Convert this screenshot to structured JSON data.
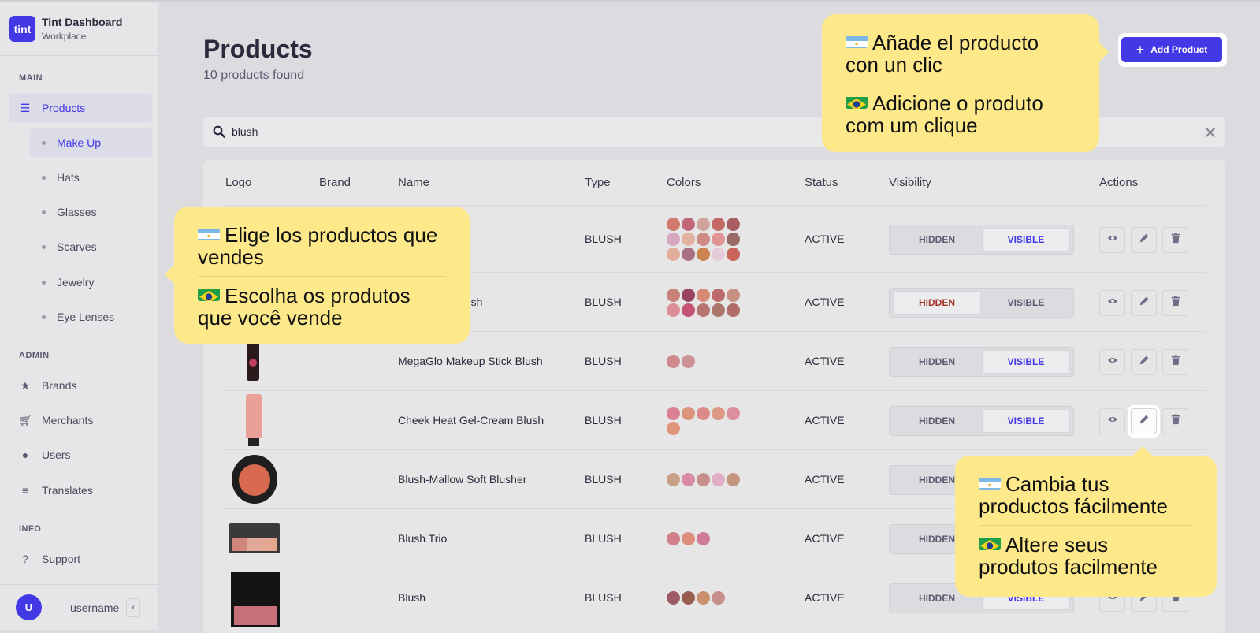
{
  "app": {
    "logo_text": "tint",
    "title": "Tint Dashboard",
    "subtitle": "Workplace"
  },
  "sidebar": {
    "sections": {
      "main": "MAIN",
      "admin": "ADMIN",
      "info": "INFO"
    },
    "products": {
      "label": "Products",
      "icon": "list-icon"
    },
    "subitems": [
      {
        "label": "Make Up"
      },
      {
        "label": "Hats"
      },
      {
        "label": "Glasses"
      },
      {
        "label": "Scarves"
      },
      {
        "label": "Jewelry"
      },
      {
        "label": "Eye Lenses"
      }
    ],
    "admin_items": [
      {
        "label": "Brands",
        "icon": "star-icon"
      },
      {
        "label": "Merchants",
        "icon": "cart-icon"
      },
      {
        "label": "Users",
        "icon": "user-icon"
      },
      {
        "label": "Translates",
        "icon": "text-lines-icon"
      }
    ],
    "info_items": [
      {
        "label": "Support",
        "icon": "question-icon"
      }
    ],
    "user": {
      "initial": "U",
      "name": "username",
      "collapse": "‹"
    }
  },
  "page": {
    "title": "Products",
    "count": "10 products found",
    "add_button": "Add Product"
  },
  "search": {
    "value": "blush",
    "placeholder": ""
  },
  "table": {
    "headers": {
      "logo": "Logo",
      "brand": "Brand",
      "name": "Name",
      "type": "Type",
      "colors": "Colors",
      "status": "Status",
      "visibility": "Visibility",
      "actions": "Actions"
    },
    "visibility_options": {
      "hidden": "HIDDEN",
      "visible": "VISIBLE"
    },
    "rows": [
      {
        "name": "",
        "type": "BLUSH",
        "status": "ACTIVE",
        "visibility": "visible",
        "colors": [
          "#d27a6e",
          "#c0687a",
          "#cfa49a",
          "#c46a66",
          "#a85e60",
          "#d6a8c0",
          "#e2b2a2",
          "#d08a86",
          "#e09494",
          "#9a6a66",
          "#e0ae9a",
          "#a87080",
          "#cc8450",
          "#e6ccd8",
          "#c86458"
        ]
      },
      {
        "name": "ay 12 Hour Blush",
        "type": "BLUSH",
        "status": "ACTIVE",
        "visibility": "hidden",
        "colors": [
          "#c8827a",
          "#98445e",
          "#d88a76",
          "#bc6a6a",
          "#c89080",
          "#dc8e98",
          "#c45272",
          "#b87470",
          "#ac766a",
          "#b06c66"
        ]
      },
      {
        "name": "MegaGlo Makeup Stick Blush",
        "type": "BLUSH",
        "status": "ACTIVE",
        "visibility": "visible",
        "colors": [
          "#cc8a8e",
          "#cc9294"
        ]
      },
      {
        "name": "Cheek Heat Gel-Cream Blush",
        "type": "BLUSH",
        "status": "ACTIVE",
        "visibility": "visible",
        "colors": [
          "#dc8096",
          "#dc947c",
          "#dc8a8a",
          "#dc9a84",
          "#dc8e9c",
          "#e0947c"
        ]
      },
      {
        "name": "Blush-Mallow Soft Blusher",
        "type": "BLUSH",
        "status": "ACTIVE",
        "visibility": "visible",
        "colors": [
          "#c8a088",
          "#d88aa6",
          "#c88e8a",
          "#e0aec4",
          "#c4967e"
        ]
      },
      {
        "name": "Blush Trio",
        "type": "BLUSH",
        "status": "ACTIVE",
        "visibility": "visible",
        "colors": [
          "#d08088",
          "#e08e7e",
          "#d07c96"
        ]
      },
      {
        "name": "Blush",
        "type": "BLUSH",
        "status": "ACTIVE",
        "visibility": "visible",
        "colors": [
          "#9c5c66",
          "#9a5e50",
          "#c8906c",
          "#c88e8c"
        ]
      }
    ]
  },
  "tooltips": {
    "add": {
      "es": "Añade el producto con un clic",
      "pt": "Adicione o produto com um clique"
    },
    "choose": {
      "es": "Elige los productos que vendes",
      "pt": "Escolha os produtos que você vende"
    },
    "edit": {
      "es": "Cambia tus productos fácilmente",
      "pt": "Altere seus produtos facilmente"
    }
  },
  "colors": {
    "accent": "#4338e6",
    "tooltip": "#fde98a",
    "hidden_active": "#a3362a"
  }
}
